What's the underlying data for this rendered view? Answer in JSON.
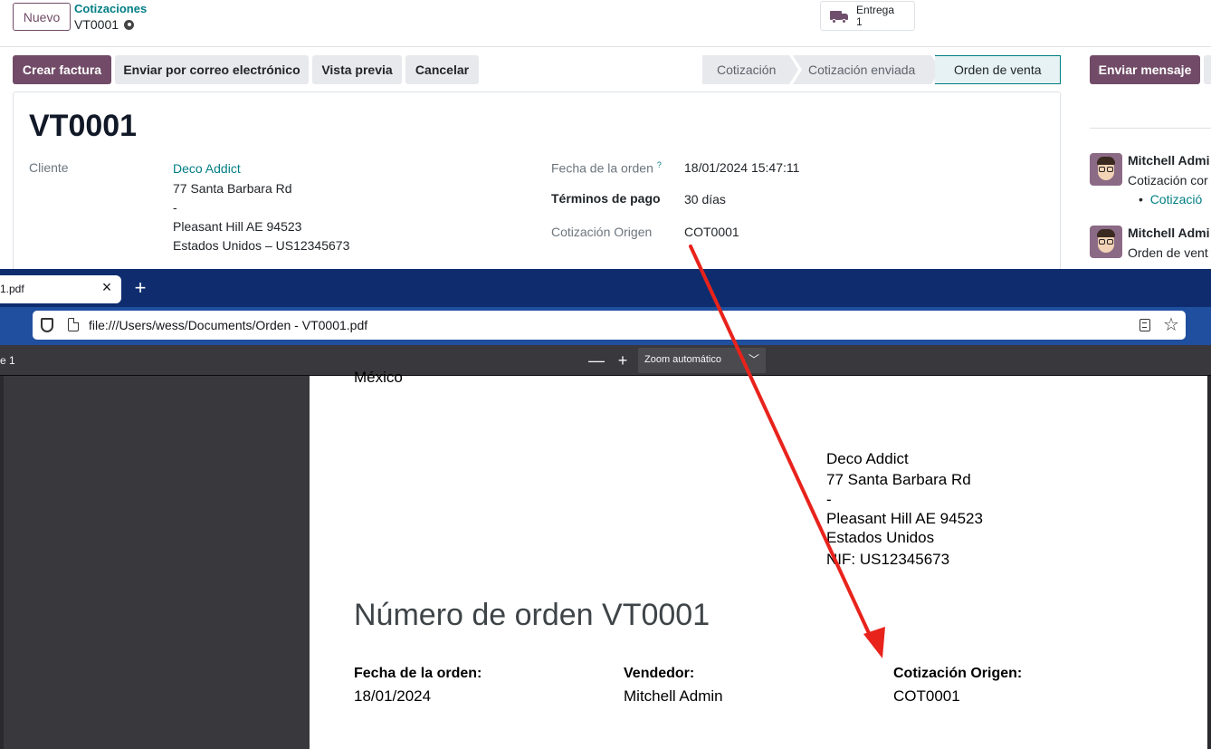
{
  "odoo": {
    "new_button": "Nuevo",
    "breadcrumb_parent": "Cotizaciones",
    "breadcrumb_current": "VT0001",
    "smart_button": {
      "label": "Entrega",
      "count": "1"
    },
    "actions": {
      "create_invoice": "Crear factura",
      "send_email": "Enviar por correo electrónico",
      "preview": "Vista previa",
      "cancel": "Cancelar"
    },
    "status_stages": [
      "Cotización",
      "Cotización enviada",
      "Orden de venta"
    ],
    "active_stage": "Orden de venta",
    "record": {
      "name": "VT0001",
      "customer_label": "Cliente",
      "customer_name": "Deco Addict",
      "customer_address": [
        "77 Santa Barbara Rd",
        "-",
        "Pleasant Hill AE 94523",
        "Estados Unidos – US12345673"
      ],
      "order_date_label": "Fecha de la orden",
      "order_date_help": "?",
      "order_date": "18/01/2024 15:47:11",
      "payment_terms_label": "Términos de pago",
      "payment_terms": "30 días",
      "origin_label": "Cotización Origen",
      "origin": "COT0001"
    },
    "chatter": {
      "send_message": "Enviar mensaje",
      "messages": [
        {
          "author": "Mitchell Admi",
          "body": "Cotización cor",
          "bullet": "Cotizació"
        },
        {
          "author": "Mitchell Admi",
          "body": "Orden de vent"
        }
      ]
    }
  },
  "browser": {
    "tab_title": "1.pdf",
    "tab_close": "×",
    "new_tab": "+",
    "url": "file:///Users/wess/Documents/Orden - VT0001.pdf",
    "page_indicator": "e 1",
    "zoom_out": "—",
    "zoom_in": "+",
    "zoom_label": "Zoom automático"
  },
  "pdf": {
    "top_line": "México",
    "address": [
      "Deco Addict",
      "77 Santa Barbara Rd",
      "-",
      "Pleasant Hill AE 94523",
      "Estados Unidos",
      "NIF: US12345673"
    ],
    "title": "Número de orden VT0001",
    "fields": [
      {
        "label": "Fecha de la orden:",
        "value": "18/01/2024"
      },
      {
        "label": "Vendedor:",
        "value": "Mitchell Admin"
      },
      {
        "label": "Cotización Origen:",
        "value": "COT0001"
      }
    ]
  },
  "colors": {
    "brand": "#714b67",
    "link": "#017e84",
    "arrow": "#e8231c",
    "browser_dark": "#0f2d6e",
    "pdf_toolbar": "#38383d"
  }
}
